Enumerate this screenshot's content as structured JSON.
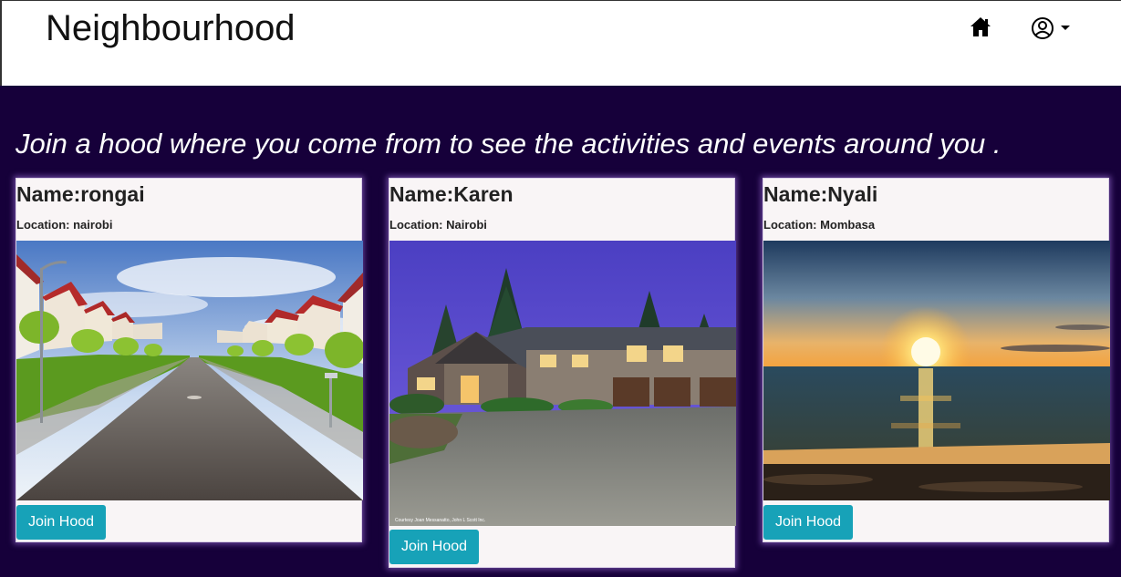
{
  "navbar": {
    "brand": "Neighbourhood",
    "home_icon": "home-icon",
    "user_icon": "user-circle-icon",
    "caret_icon": "caret-down-icon"
  },
  "main": {
    "tagline": "Join a hood where you come from to see the activities and events around you ."
  },
  "hoods": [
    {
      "name": "Name:rongai",
      "location": "Location: nairobi",
      "button": "Join Hood"
    },
    {
      "name": "Name:Karen",
      "location": "Location: Nairobi",
      "button": "Join Hood",
      "image_caption": "Courtesy Joan Messanatto, John L Scott Inc."
    },
    {
      "name": "Name:Nyali",
      "location": "Location: Mombasa",
      "button": "Join Hood"
    }
  ],
  "colors": {
    "background": "#16003a",
    "card": "#f9f5f6",
    "button": "#17a2b8"
  }
}
